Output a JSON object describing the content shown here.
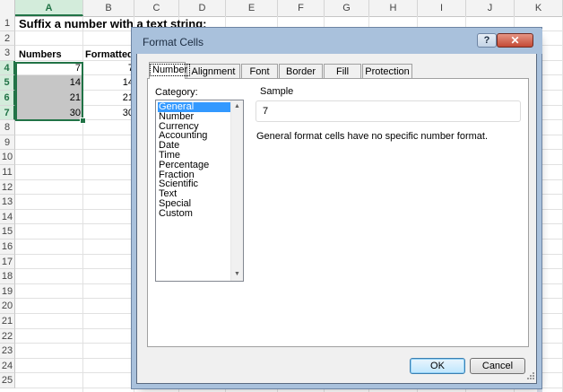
{
  "sheet": {
    "columns": [
      "A",
      "B",
      "C",
      "D",
      "E",
      "F",
      "G",
      "H",
      "I",
      "J",
      "K"
    ],
    "rows": [
      "1",
      "2",
      "3",
      "4",
      "5",
      "6",
      "7",
      "8",
      "9",
      "10",
      "11",
      "12",
      "13",
      "14",
      "15",
      "16",
      "17",
      "18",
      "19",
      "20",
      "21",
      "22",
      "23",
      "24",
      "25"
    ],
    "title": "Suffix a number with a text string:",
    "header_a": "Numbers",
    "header_b": "Formatted",
    "values_a": [
      "7",
      "14",
      "21",
      "30"
    ],
    "values_b": [
      "7",
      "14",
      "21",
      "30"
    ]
  },
  "dialog": {
    "title": "Format Cells",
    "help_label": "?",
    "close_label": "✕",
    "tabs": [
      "Number",
      "Alignment",
      "Font",
      "Border",
      "Fill",
      "Protection"
    ],
    "category_label": "Category:",
    "categories": [
      "General",
      "Number",
      "Currency",
      "Accounting",
      "Date",
      "Time",
      "Percentage",
      "Fraction",
      "Scientific",
      "Text",
      "Special",
      "Custom"
    ],
    "selected_category": "General",
    "sample_label": "Sample",
    "sample_value": "7",
    "description": "General format cells have no specific number format.",
    "ok_label": "OK",
    "cancel_label": "Cancel"
  },
  "colors": {
    "accent": "#217346",
    "selection": "#3399ff",
    "title_bar": "#a9c1dc",
    "close_button": "#c44a35"
  }
}
